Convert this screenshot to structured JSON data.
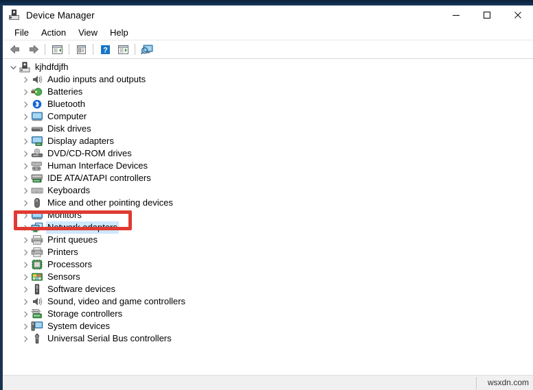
{
  "window": {
    "title": "Device Manager",
    "icon": "device-manager-icon",
    "controls": [
      {
        "name": "minimize-button",
        "glyph": "minimize"
      },
      {
        "name": "maximize-button",
        "glyph": "maximize"
      },
      {
        "name": "close-button",
        "glyph": "close"
      }
    ]
  },
  "menubar": {
    "items": [
      {
        "label": "File"
      },
      {
        "label": "Action"
      },
      {
        "label": "View"
      },
      {
        "label": "Help"
      }
    ]
  },
  "toolbar": {
    "buttons": [
      {
        "name": "back-button",
        "icon": "back-arrow-icon",
        "tooltip": "Back"
      },
      {
        "name": "forward-button",
        "icon": "forward-arrow-icon",
        "tooltip": "Forward"
      },
      {
        "name": "show-hide-console-tree-button",
        "icon": "console-tree-icon",
        "tooltip": "Show/Hide Console Tree"
      },
      {
        "name": "properties-button",
        "icon": "properties-icon",
        "tooltip": "Properties"
      },
      {
        "name": "help-button",
        "icon": "help-question-icon",
        "tooltip": "Help"
      },
      {
        "name": "update-driver-button",
        "icon": "update-driver-icon",
        "tooltip": "Update driver"
      },
      {
        "name": "scan-for-hardware-changes-button",
        "icon": "scan-hardware-icon",
        "tooltip": "Scan for hardware changes"
      }
    ]
  },
  "tree": {
    "root": {
      "label": "kjhdfdjfh",
      "icon": "computer-root-icon",
      "expanded": true
    },
    "items": [
      {
        "label": "Audio inputs and outputs",
        "icon": "speaker-icon",
        "selected": false
      },
      {
        "label": "Batteries",
        "icon": "battery-icon",
        "selected": false
      },
      {
        "label": "Bluetooth",
        "icon": "bluetooth-icon",
        "selected": false
      },
      {
        "label": "Computer",
        "icon": "monitor-icon",
        "selected": false
      },
      {
        "label": "Disk drives",
        "icon": "disk-drive-icon",
        "selected": false
      },
      {
        "label": "Display adapters",
        "icon": "display-adapter-icon",
        "selected": false
      },
      {
        "label": "DVD/CD-ROM drives",
        "icon": "optical-drive-icon",
        "selected": false
      },
      {
        "label": "Human Interface Devices",
        "icon": "hid-gamepad-icon",
        "selected": false
      },
      {
        "label": "IDE ATA/ATAPI controllers",
        "icon": "ide-controller-icon",
        "selected": false
      },
      {
        "label": "Keyboards",
        "icon": "keyboard-icon",
        "selected": false
      },
      {
        "label": "Mice and other pointing devices",
        "icon": "mouse-icon",
        "selected": false
      },
      {
        "label": "Monitors",
        "icon": "monitor-icon",
        "selected": false
      },
      {
        "label": "Network adapters",
        "icon": "network-adapter-icon",
        "selected": true
      },
      {
        "label": "Print queues",
        "icon": "print-queue-icon",
        "selected": false
      },
      {
        "label": "Printers",
        "icon": "printer-icon",
        "selected": false
      },
      {
        "label": "Processors",
        "icon": "processor-icon",
        "selected": false
      },
      {
        "label": "Sensors",
        "icon": "sensor-icon",
        "selected": false
      },
      {
        "label": "Software devices",
        "icon": "software-device-icon",
        "selected": false
      },
      {
        "label": "Sound, video and game controllers",
        "icon": "speaker-icon",
        "selected": false
      },
      {
        "label": "Storage controllers",
        "icon": "storage-controller-icon",
        "selected": false
      },
      {
        "label": "System devices",
        "icon": "system-device-icon",
        "selected": false
      },
      {
        "label": "Universal Serial Bus controllers",
        "icon": "usb-icon",
        "selected": false
      }
    ]
  },
  "annotation": {
    "highlight_target": "Network adapters",
    "color": "#e03a32",
    "shape": "rectangle"
  },
  "statusbar": {
    "watermark": "wsxdn.com"
  },
  "colors": {
    "selection": "#cde8ff",
    "annotation_red": "#e03a32",
    "window_border": "#1b3350",
    "desktop_strip": "#102a48"
  }
}
